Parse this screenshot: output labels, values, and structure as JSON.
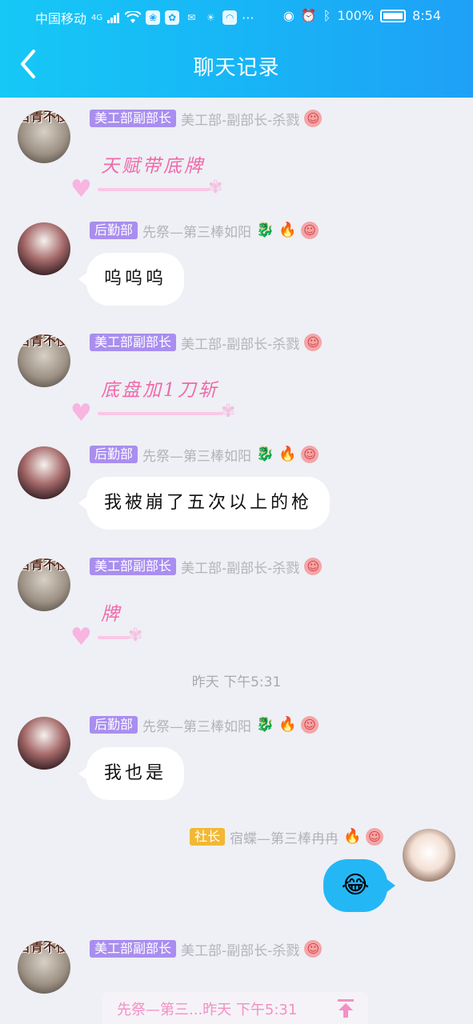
{
  "status_bar": {
    "carrier": "中国移动",
    "network": "4G",
    "battery": "100%",
    "time": "8:54"
  },
  "header": {
    "title": "聊天记录"
  },
  "messages": [
    {
      "side": "left",
      "avatar_text": "百青不侵",
      "badge": "美工部副部长",
      "nick": "美工部-副部长-杀戮",
      "fancy_text": "天赋带底牌"
    },
    {
      "side": "left",
      "badge": "后勤部",
      "nick": "先祭—第三棒如阳",
      "text": "呜呜呜"
    },
    {
      "side": "left",
      "avatar_text": "百青不侵",
      "badge": "美工部副部长",
      "nick": "美工部-副部长-杀戮",
      "fancy_text": "底盘加1刀斩"
    },
    {
      "side": "left",
      "badge": "后勤部",
      "nick": "先祭—第三棒如阳",
      "text": "我被崩了五次以上的枪"
    },
    {
      "side": "left",
      "avatar_text": "百青不侵",
      "badge": "美工部副部长",
      "nick": "美工部-副部长-杀戮",
      "fancy_text": "牌"
    },
    {
      "side": "left",
      "badge": "后勤部",
      "nick": "先祭—第三棒如阳",
      "text": "我也是"
    },
    {
      "side": "right",
      "badge": "社长",
      "nick": "宿蝶—第三棒冉冉",
      "emoji": "😂"
    },
    {
      "side": "left",
      "avatar_text": "百青不侵",
      "badge": "美工部副部长",
      "nick": "美工部-副部长-杀戮"
    }
  ],
  "time_separator": "昨天 下午5:31",
  "bottom_bar": {
    "text": "先祭—第三...昨天 下午5:31"
  },
  "colors": {
    "header_start": "#16c8f6",
    "header_end": "#1fa0f7",
    "badge_purple": "#a98ef0",
    "badge_orange": "#f2b834",
    "my_bubble": "#24b7f6",
    "fancy_pink": "#f06aaa"
  }
}
